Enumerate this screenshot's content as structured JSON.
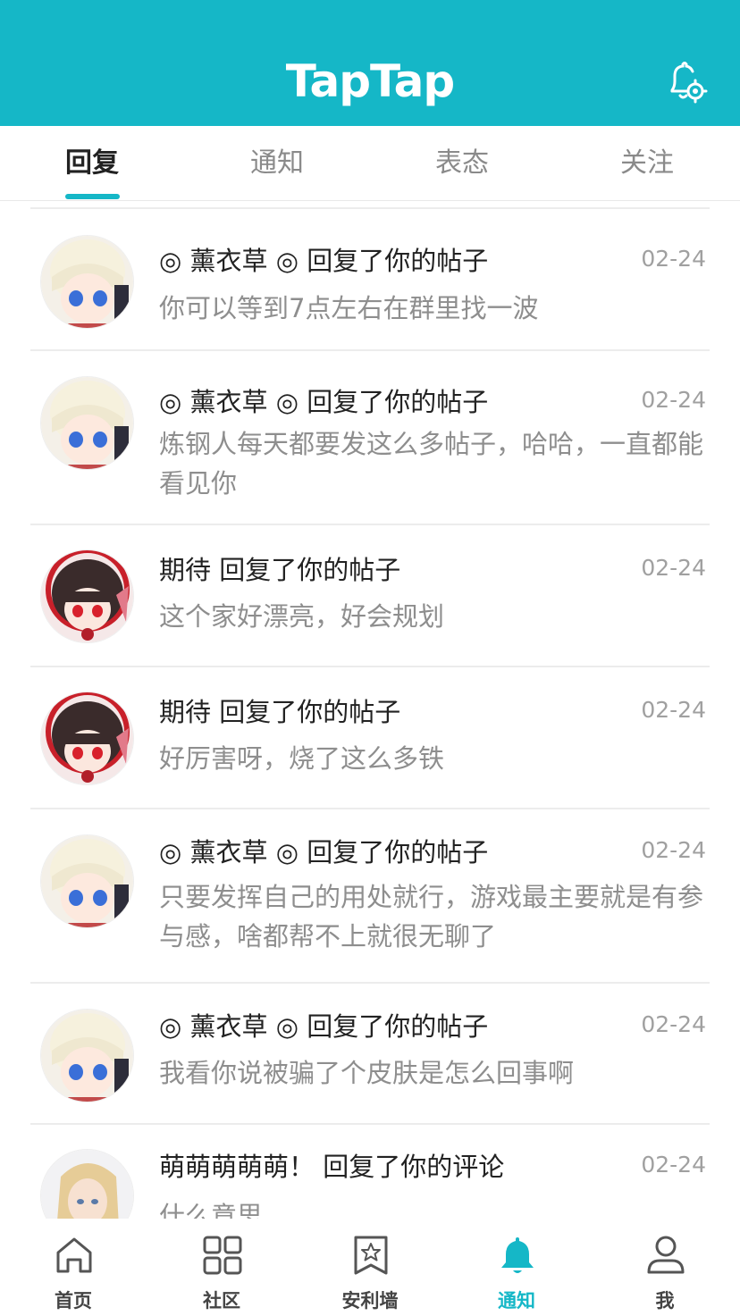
{
  "header": {
    "logo": "TapTap",
    "settings_icon": "bell-settings-icon"
  },
  "tabs": [
    {
      "label": "回复",
      "active": true
    },
    {
      "label": "通知",
      "active": false
    },
    {
      "label": "表态",
      "active": false
    },
    {
      "label": "关注",
      "active": false
    }
  ],
  "messages": [
    {
      "title": "◎ 薰衣草 ◎ 回复了你的帖子",
      "date": "02-24",
      "body": "你可以等到7点左右在群里找一波",
      "avatar": "white-hair-avatar"
    },
    {
      "title": "◎ 薰衣草 ◎ 回复了你的帖子",
      "date": "02-24",
      "body": "炼钢人每天都要发这么多帖子，哈哈，一直都能看见你",
      "avatar": "white-hair-avatar"
    },
    {
      "title": "期待 回复了你的帖子",
      "date": "02-24",
      "body": "这个家好漂亮，好会规划",
      "avatar": "dark-hair-avatar"
    },
    {
      "title": "期待 回复了你的帖子",
      "date": "02-24",
      "body": "好厉害呀，烧了这么多铁",
      "avatar": "dark-hair-avatar"
    },
    {
      "title": "◎ 薰衣草 ◎ 回复了你的帖子",
      "date": "02-24",
      "body": "只要发挥自己的用处就行，游戏最主要就是有参与感，啥都帮不上就很无聊了",
      "avatar": "white-hair-avatar"
    },
    {
      "title": "◎ 薰衣草 ◎ 回复了你的帖子",
      "date": "02-24",
      "body": "我看你说被骗了个皮肤是怎么回事啊",
      "avatar": "white-hair-avatar"
    },
    {
      "title": "萌萌萌萌萌！ 回复了你的评论",
      "date": "02-24",
      "body": "什么意思",
      "avatar": "blonde-hair-avatar"
    }
  ],
  "bottom_nav": [
    {
      "label": "首页",
      "icon": "home-icon",
      "active": false
    },
    {
      "label": "社区",
      "icon": "grid-icon",
      "active": false
    },
    {
      "label": "安利墙",
      "icon": "bookmark-star-icon",
      "active": false
    },
    {
      "label": "通知",
      "icon": "bell-icon",
      "active": true
    },
    {
      "label": "我",
      "icon": "person-icon",
      "active": false
    }
  ],
  "colors": {
    "accent": "#15b7c7",
    "title": "#222222",
    "body": "#8e8e8e",
    "date": "#a0a0a0"
  }
}
